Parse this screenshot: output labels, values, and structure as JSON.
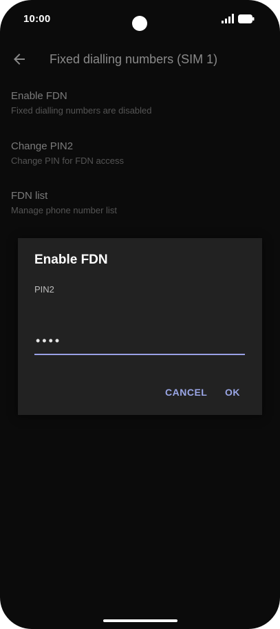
{
  "status_bar": {
    "time": "10:00",
    "signal_icon": "signal-icon",
    "battery_icon": "battery-icon"
  },
  "app_bar": {
    "back_icon": "arrow-back-icon",
    "title": "Fixed dialling numbers (SIM 1)"
  },
  "preferences": [
    {
      "title": "Enable FDN",
      "summary": "Fixed dialling numbers are disabled"
    },
    {
      "title": "Change PIN2",
      "summary": "Change PIN for FDN access"
    },
    {
      "title": "FDN list",
      "summary": "Manage phone number list"
    }
  ],
  "dialog": {
    "title": "Enable FDN",
    "field_label": "PIN2",
    "field_value": "••••",
    "cancel_label": "CANCEL",
    "ok_label": "OK"
  },
  "colors": {
    "background": "#0b0b0b",
    "dialog": "#222222",
    "accent": "#9aa6e6"
  }
}
